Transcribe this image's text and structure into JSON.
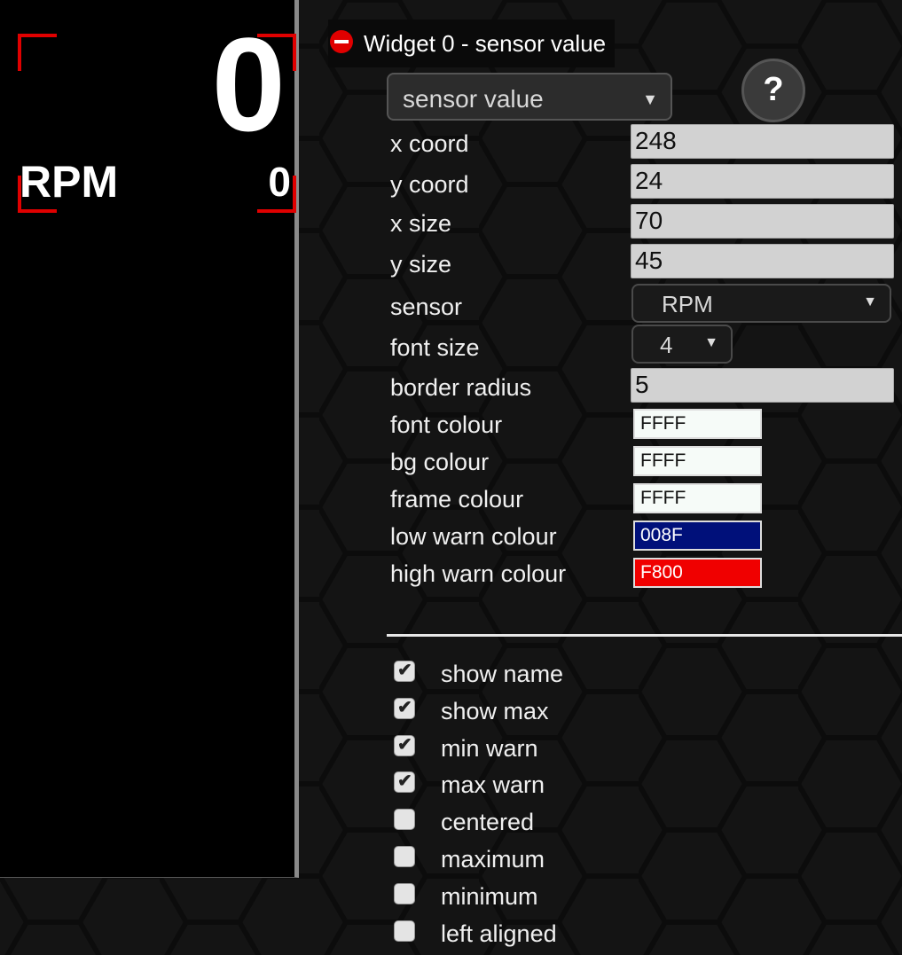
{
  "preview": {
    "value": "0",
    "sensor_name": "RPM",
    "max_value": "0"
  },
  "widget": {
    "header": "Widget 0 - sensor value",
    "type_select": "sensor value",
    "help_label": "?"
  },
  "fields": {
    "x_coord": {
      "label": "x coord",
      "value": "248"
    },
    "y_coord": {
      "label": "y coord",
      "value": "24"
    },
    "x_size": {
      "label": "x size",
      "value": "70"
    },
    "y_size": {
      "label": "y size",
      "value": "45"
    },
    "sensor": {
      "label": "sensor",
      "value": "RPM"
    },
    "font_size": {
      "label": "font size",
      "value": "4"
    },
    "border_radius": {
      "label": "border radius",
      "value": "5"
    },
    "font_colour": {
      "label": "font colour",
      "value": "FFFF",
      "bg": "#f6fbf8",
      "fg": "#111111"
    },
    "bg_colour": {
      "label": "bg colour",
      "value": "FFFF",
      "bg": "#f6fbf8",
      "fg": "#111111"
    },
    "frame_colour": {
      "label": "frame colour",
      "value": "FFFF",
      "bg": "#f6fbf8",
      "fg": "#111111"
    },
    "low_warn_colour": {
      "label": "low warn colour",
      "value": "008F",
      "bg": "#00107a",
      "fg": "#ffffff"
    },
    "high_warn_colour": {
      "label": "high warn colour",
      "value": "F800",
      "bg": "#f00000",
      "fg": "#ffffff"
    }
  },
  "options": [
    {
      "label": "show name",
      "checked": true
    },
    {
      "label": "show max",
      "checked": true
    },
    {
      "label": "min warn",
      "checked": true
    },
    {
      "label": "max warn",
      "checked": true
    },
    {
      "label": "centered",
      "checked": false
    },
    {
      "label": "maximum",
      "checked": false
    },
    {
      "label": "minimum",
      "checked": false
    },
    {
      "label": "left aligned",
      "checked": false
    }
  ],
  "colors": {
    "frame_accent": "#e00000",
    "remove_icon": "#e00000"
  }
}
